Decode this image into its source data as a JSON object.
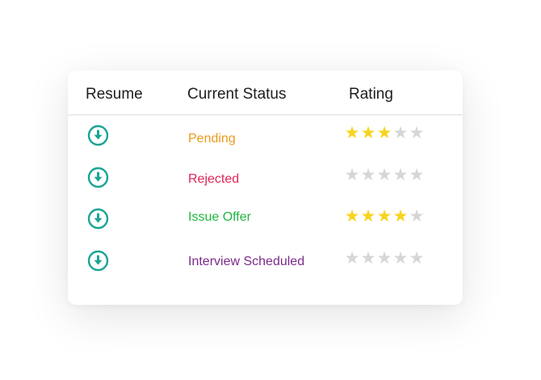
{
  "table": {
    "headers": {
      "resume": "Resume",
      "status": "Current Status",
      "rating": "Rating"
    },
    "rows": [
      {
        "status": "Pending",
        "status_color": "#ea9a1b",
        "rating": 3,
        "max_rating": 5
      },
      {
        "status": "Rejected",
        "status_color": "#dd2658",
        "rating": 0,
        "max_rating": 5
      },
      {
        "status": "Issue Offer",
        "status_color": "#1fb63f",
        "rating": 4,
        "max_rating": 5
      },
      {
        "status": "Interview Scheduled",
        "status_color": "#7b2b8c",
        "rating": 0,
        "max_rating": 5
      }
    ]
  },
  "colors": {
    "download_icon": "#1aa596",
    "star_filled": "#f7d41c",
    "star_empty": "#d6d6d6"
  },
  "icons": {
    "download": "download-icon",
    "star": "star-icon"
  }
}
